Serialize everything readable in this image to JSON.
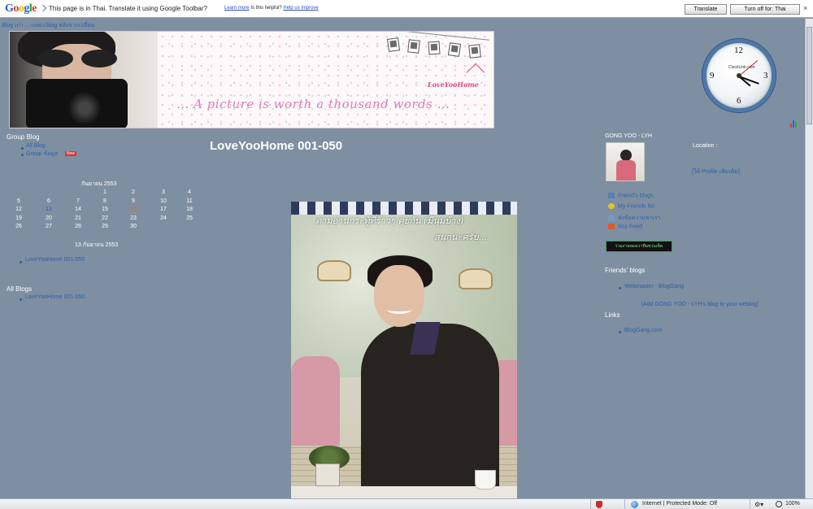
{
  "translate_bar": {
    "logo": "Google",
    "message": "This page is in Thai. Translate it using Google Toolbar?",
    "learn_more": "Learn more",
    "was_helpful": "Is this helpful?",
    "help_improve": "Help us improve",
    "translate_label": "Translate",
    "turn_off_label": "Turn off for: Thai",
    "close_label": "×"
  },
  "top_nav": "Blog เก่า ... แสดง blog หลังจากเปลี่ยน",
  "banner": {
    "tagline": "... A picture is worth a thousand words ...",
    "logo": "LoveYooHome"
  },
  "clock": {
    "brand": "ClockLink.com",
    "numerals": [
      "12",
      "3",
      "6",
      "9"
    ]
  },
  "left": {
    "group_blog_heading": "Group Blog",
    "group_blog_items": [
      "All Blog",
      "Group ข้อมูล"
    ],
    "new_badge": "New",
    "calendar": {
      "title": "กันยายน 2553",
      "rows": [
        [
          "",
          "",
          "",
          "1",
          "2",
          "3",
          "4"
        ],
        [
          "5",
          "6",
          "7",
          "8",
          "9",
          "10",
          "11"
        ],
        [
          "12",
          "13",
          "14",
          "15",
          "16",
          "17",
          "18"
        ],
        [
          "19",
          "20",
          "21",
          "22",
          "23",
          "24",
          "25"
        ],
        [
          "26",
          "27",
          "28",
          "29",
          "30",
          "",
          ""
        ]
      ],
      "linked_days": [
        "13"
      ],
      "today": "16"
    },
    "entry_date": "13 กันยายน 2553",
    "entry_item": "LoveYooHome 001-050",
    "all_blogs_heading": "All Blogs",
    "all_blogs_item": "LoveYooHome 001-050"
  },
  "post": {
    "title": "LoveYooHome 001-050",
    "photo_text_line1": "ตามอ่านกระทู้ที่ร้าวๆ คุยกัน (มีนุ่มบ้าง)",
    "photo_text_line2": "สนุกนะครับ..."
  },
  "right": {
    "profile_name": "GONG YOO - LYH",
    "location": "Location :",
    "view_profile": "[ให้ Profile เพิ่มเติม]",
    "feeds": [
      {
        "label": "Friend's blogs",
        "icon": "friends-icon",
        "color": "#5a7fb0"
      },
      {
        "label": "My Friends list",
        "icon": "smiley-icon",
        "color": "#e6c229"
      },
      {
        "label": "ส่งข้อความหาเรา",
        "icon": "chat-icon",
        "color": "#7a98c6"
      },
      {
        "label": "Rss Feed",
        "icon": "rss-icon",
        "color": "#e05a2a"
      }
    ],
    "badge": "ร่วมงานของเราทีมชวนเช็ค",
    "friends_heading": "Friends' blogs",
    "friend_item": "Webmaster - BlogGang",
    "add_link": "[Add GONG YOO - LYH's blog to your weblog]",
    "links_heading": "Links",
    "links_item": "BlogGang.com"
  },
  "statusbar": {
    "zone": "Internet | Protected Mode: Off",
    "zoom": "100%"
  }
}
